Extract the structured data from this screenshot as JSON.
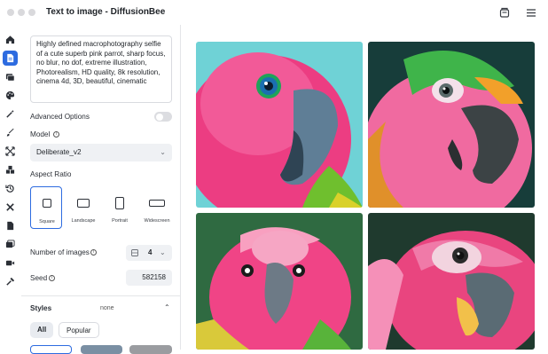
{
  "window": {
    "title": "Text to image - DiffusionBee"
  },
  "toolbar": {
    "icons": [
      "history-icon",
      "menu-icon"
    ]
  },
  "sidebar": {
    "items": [
      {
        "name": "home-icon"
      },
      {
        "name": "text-to-image-icon",
        "active": true
      },
      {
        "name": "image-to-image-icon"
      },
      {
        "name": "palette-icon"
      },
      {
        "name": "magic-wand-icon"
      },
      {
        "name": "brush-icon"
      },
      {
        "name": "expand-icon"
      },
      {
        "name": "blocks-icon"
      },
      {
        "name": "history-rail-icon"
      },
      {
        "name": "tools-icon"
      },
      {
        "name": "document-icon"
      },
      {
        "name": "gallery-icon"
      },
      {
        "name": "video-icon"
      },
      {
        "name": "hammer-icon"
      }
    ]
  },
  "prompt": {
    "value": "Highly defined macrophotography selfie of a cute superb pink parrot, sharp focus, no blur, no dof, extreme illustration, Photorealism, HD quality, 8k resolution, cinema 4d, 3D, beautiful, cinematic"
  },
  "advanced_options": {
    "label": "Advanced Options",
    "enabled": false
  },
  "model": {
    "label": "Model",
    "value": "Deliberate_v2"
  },
  "aspect_ratio": {
    "label": "Aspect Ratio",
    "options": [
      {
        "label": "Square",
        "selected": true
      },
      {
        "label": "Landscape",
        "selected": false
      },
      {
        "label": "Portrait",
        "selected": false
      },
      {
        "label": "Widescreen",
        "selected": false
      }
    ]
  },
  "num_images": {
    "label": "Number of images",
    "value": "4"
  },
  "seed": {
    "label": "Seed",
    "value": "582158"
  },
  "styles": {
    "label": "Styles",
    "value": "none",
    "tabs": [
      "All",
      "Popular"
    ]
  },
  "colors": {
    "accent": "#2d6be0",
    "panel_border": "#e4e5e8",
    "field_bg": "#eff1f4"
  }
}
